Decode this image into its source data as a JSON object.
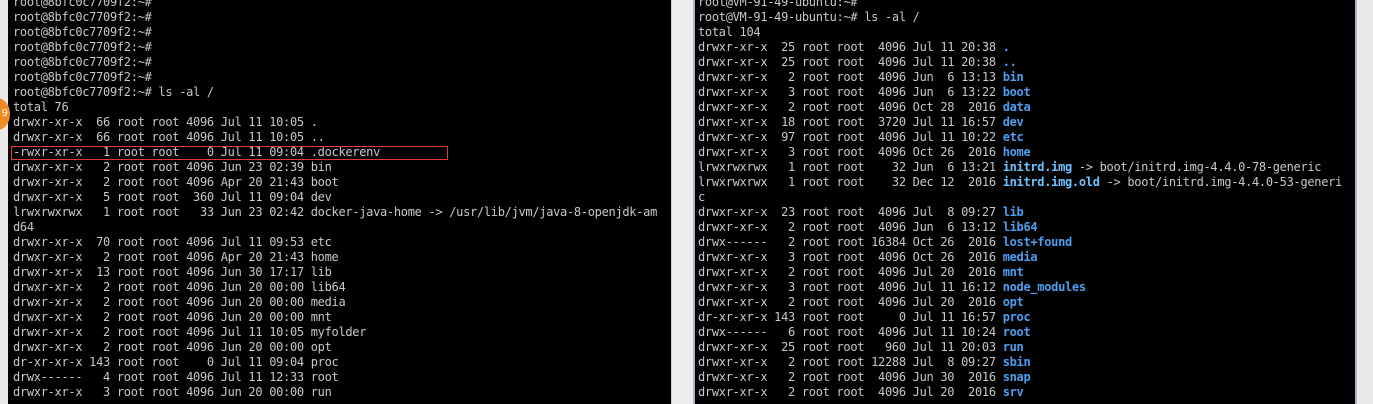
{
  "left_terminal": {
    "lines": [
      {
        "text": "root@8bfc0c7709f2:~#"
      },
      {
        "text": "root@8bfc0c7709f2:~#"
      },
      {
        "text": "root@8bfc0c7709f2:~#"
      },
      {
        "text": "root@8bfc0c7709f2:~#"
      },
      {
        "text": "root@8bfc0c7709f2:~#"
      },
      {
        "text": "root@8bfc0c7709f2:~#"
      },
      {
        "text": "root@8bfc0c7709f2:~# ls -al /"
      },
      {
        "text": "total 76"
      },
      {
        "text": "drwxr-xr-x  66 root root 4096 Jul 11 10:05 ."
      },
      {
        "text": "drwxr-xr-x  66 root root 4096 Jul 11 10:05 .."
      },
      {
        "text": "-rwxr-xr-x   1 root root    0 Jul 11 09:04 .dockerenv"
      },
      {
        "text": "drwxr-xr-x   2 root root 4096 Jun 23 02:39 bin"
      },
      {
        "text": "drwxr-xr-x   2 root root 4096 Apr 20 21:43 boot"
      },
      {
        "text": "drwxr-xr-x   5 root root  360 Jul 11 09:04 dev"
      },
      {
        "text": "lrwxrwxrwx   1 root root   33 Jun 23 02:42 docker-java-home -> /usr/lib/jvm/java-8-openjdk-am"
      },
      {
        "text": "d64"
      },
      {
        "text": "drwxr-xr-x  70 root root 4096 Jul 11 09:53 etc"
      },
      {
        "text": "drwxr-xr-x   2 root root 4096 Apr 20 21:43 home"
      },
      {
        "text": "drwxr-xr-x  13 root root 4096 Jun 30 17:17 lib"
      },
      {
        "text": "drwxr-xr-x   2 root root 4096 Jun 20 00:00 lib64"
      },
      {
        "text": "drwxr-xr-x   2 root root 4096 Jun 20 00:00 media"
      },
      {
        "text": "drwxr-xr-x   2 root root 4096 Jun 20 00:00 mnt"
      },
      {
        "text": "drwxr-xr-x   2 root root 4096 Jul 11 10:05 myfolder"
      },
      {
        "text": "drwxr-xr-x   2 root root 4096 Jun 20 00:00 opt"
      },
      {
        "text": "dr-xr-xr-x 143 root root    0 Jul 11 09:04 proc"
      },
      {
        "text": "drwx------   4 root root 4096 Jul 11 12:33 root"
      },
      {
        "text": "drwxr-xr-x   3 root root 4096 Jun 20 00:00 run"
      }
    ],
    "badge_text": "9"
  },
  "right_terminal": {
    "lines": [
      {
        "prefix": "root@VM-91-49-ubuntu:~#",
        "name": "",
        "style": ""
      },
      {
        "prefix": "root@VM-91-49-ubuntu:~# ls -al /",
        "name": "",
        "style": ""
      },
      {
        "prefix": "total 104",
        "name": "",
        "style": ""
      },
      {
        "prefix": "drwxr-xr-x  25 root root  4096 Jul 11 20:38 ",
        "name": ".",
        "style": "dir"
      },
      {
        "prefix": "drwxr-xr-x  25 root root  4096 Jul 11 20:38 ",
        "name": "..",
        "style": "dir"
      },
      {
        "prefix": "drwxr-xr-x   2 root root  4096 Jun  6 13:13 ",
        "name": "bin",
        "style": "dir"
      },
      {
        "prefix": "drwxr-xr-x   3 root root  4096 Jun  6 13:22 ",
        "name": "boot",
        "style": "dir"
      },
      {
        "prefix": "drwxr-xr-x   2 root root  4096 Oct 28  2016 ",
        "name": "data",
        "style": "dir"
      },
      {
        "prefix": "drwxr-xr-x  18 root root  3720 Jul 11 16:57 ",
        "name": "dev",
        "style": "dir"
      },
      {
        "prefix": "drwxr-xr-x  97 root root  4096 Jul 11 10:22 ",
        "name": "etc",
        "style": "dir"
      },
      {
        "prefix": "drwxr-xr-x   3 root root  4096 Oct 26  2016 ",
        "name": "home",
        "style": "dir"
      },
      {
        "prefix": "lrwxrwxrwx   1 root root    32 Jun  6 13:21 ",
        "name": "initrd.img",
        "style": "link",
        "suffix": " -> boot/initrd.img-4.4.0-78-generic"
      },
      {
        "prefix": "lrwxrwxrwx   1 root root    32 Dec 12  2016 ",
        "name": "initrd.img.old",
        "style": "link",
        "suffix": " -> boot/initrd.img-4.4.0-53-generi"
      },
      {
        "prefix": "c",
        "name": "",
        "style": ""
      },
      {
        "prefix": "drwxr-xr-x  23 root root  4096 Jul  8 09:27 ",
        "name": "lib",
        "style": "dir"
      },
      {
        "prefix": "drwxr-xr-x   2 root root  4096 Jun  6 13:12 ",
        "name": "lib64",
        "style": "dir"
      },
      {
        "prefix": "drwx------   2 root root 16384 Oct 26  2016 ",
        "name": "lost+found",
        "style": "dir"
      },
      {
        "prefix": "drwxr-xr-x   3 root root  4096 Oct 26  2016 ",
        "name": "media",
        "style": "dir"
      },
      {
        "prefix": "drwxr-xr-x   2 root root  4096 Jul 20  2016 ",
        "name": "mnt",
        "style": "dir"
      },
      {
        "prefix": "drwxr-xr-x   3 root root  4096 Jul 11 16:12 ",
        "name": "node_modules",
        "style": "dir"
      },
      {
        "prefix": "drwxr-xr-x   2 root root  4096 Jul 20  2016 ",
        "name": "opt",
        "style": "dir"
      },
      {
        "prefix": "dr-xr-xr-x 143 root root     0 Jul 11 16:57 ",
        "name": "proc",
        "style": "dir"
      },
      {
        "prefix": "drwx------   6 root root  4096 Jul 11 10:24 ",
        "name": "root",
        "style": "dir"
      },
      {
        "prefix": "drwxr-xr-x  25 root root   960 Jul 11 20:03 ",
        "name": "run",
        "style": "dir"
      },
      {
        "prefix": "drwxr-xr-x   2 root root 12288 Jul  8 09:27 ",
        "name": "sbin",
        "style": "dir"
      },
      {
        "prefix": "drwxr-xr-x   2 root root  4096 Jun 30  2016 ",
        "name": "snap",
        "style": "dir"
      },
      {
        "prefix": "drwxr-xr-x   2 root root  4096 Jul 20  2016 ",
        "name": "srv",
        "style": "dir"
      }
    ]
  }
}
